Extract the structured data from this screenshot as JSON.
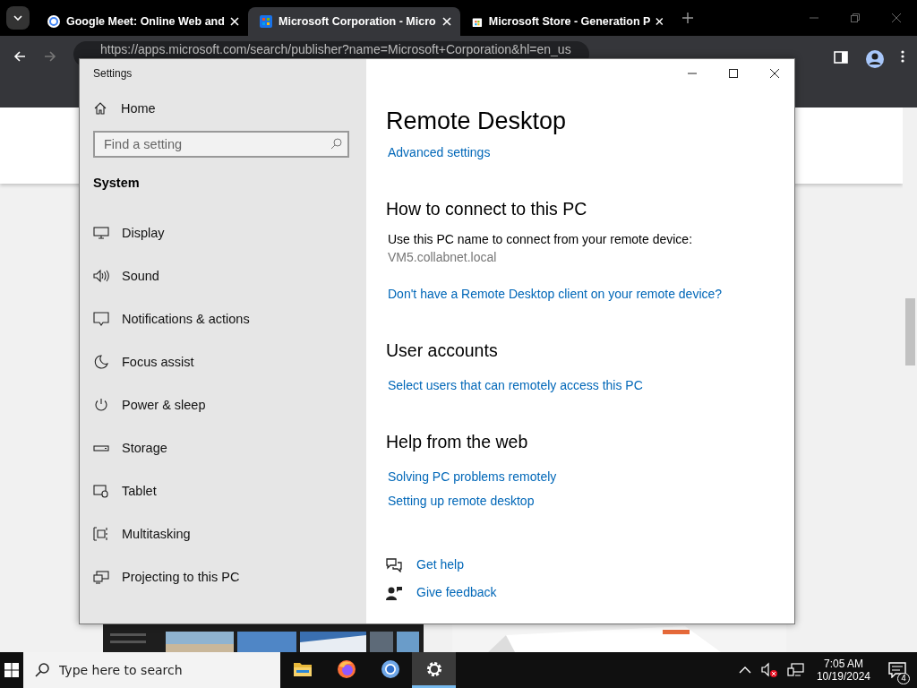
{
  "browser": {
    "tabs": [
      {
        "title": "Google Meet: Online Web and",
        "selected": false
      },
      {
        "title": "Microsoft Corporation - Micro",
        "selected": true
      },
      {
        "title": "Microsoft Store - Generation P",
        "selected": false
      }
    ],
    "address": "https://apps.microsoft.com/search/publisher?name=Microsoft+Corporation&hl=en_us"
  },
  "settings": {
    "title": "Settings",
    "sidebar": {
      "home": "Home",
      "search": {
        "placeholder": "Find a setting"
      },
      "section": "System",
      "items": [
        {
          "label": "Display",
          "selected": false
        },
        {
          "label": "Sound",
          "selected": false
        },
        {
          "label": "Notifications & actions",
          "selected": false
        },
        {
          "label": "Focus assist",
          "selected": false
        },
        {
          "label": "Power & sleep",
          "selected": false
        },
        {
          "label": "Storage",
          "selected": false
        },
        {
          "label": "Tablet",
          "selected": false
        },
        {
          "label": "Multitasking",
          "selected": false
        },
        {
          "label": "Projecting to this PC",
          "selected": false
        }
      ]
    },
    "page_title": "Remote Desktop",
    "advanced_link": "Advanced settings",
    "sections": [
      {
        "heading": "How to connect to this PC",
        "items": [
          {
            "kind": "text",
            "text": "Use this PC name to connect from your remote device:"
          },
          {
            "kind": "value",
            "text": "VM5.collabnet.local"
          },
          {
            "kind": "link",
            "text": "Don't have a Remote Desktop client on your remote device?"
          }
        ]
      },
      {
        "heading": "User accounts",
        "items": [
          {
            "kind": "link",
            "text": "Select users that can remotely access this PC"
          }
        ]
      },
      {
        "heading": "Help from the web",
        "items": [
          {
            "kind": "link",
            "text": "Solving PC problems remotely"
          },
          {
            "kind": "link",
            "text": "Setting up remote desktop"
          }
        ]
      }
    ],
    "help": [
      {
        "kind": "help",
        "text": "Get help"
      },
      {
        "kind": "feedback",
        "text": "Give feedback"
      }
    ]
  },
  "taskbar": {
    "search": {
      "placeholder": "Type here to search"
    },
    "apps": [
      {
        "kind": "folder",
        "selected": false
      },
      {
        "kind": "firefox",
        "selected": false
      },
      {
        "kind": "chrome",
        "selected": false
      },
      {
        "kind": "settings",
        "selected": true
      }
    ],
    "time": "7:05 AM",
    "date": "10/19/2024",
    "notifications": "4"
  }
}
